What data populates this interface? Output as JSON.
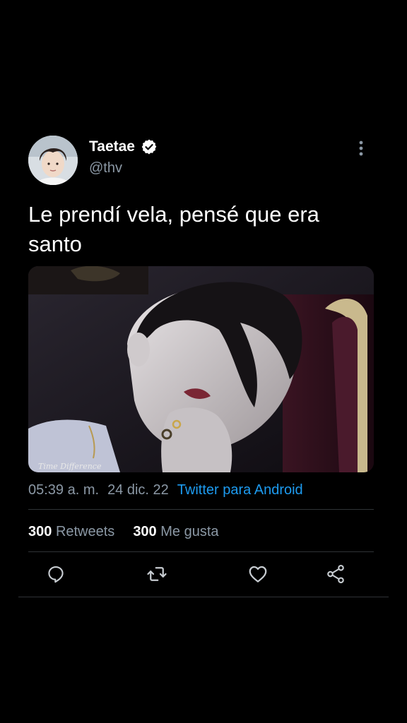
{
  "tweet": {
    "display_name": "Taetae",
    "handle": "@thv",
    "text": "Le prendí vela, pensé que era\nsanto",
    "media": {
      "watermark": "Time Difference"
    },
    "meta": {
      "time": "05:39 a. m.",
      "date": "24 dic. 22",
      "source": "Twitter para Android"
    },
    "stats": {
      "retweets_count": "300",
      "retweets_label": "Retweets",
      "likes_count": "300",
      "likes_label": "Me gusta"
    }
  },
  "icons": {
    "verified": "verified-badge-icon",
    "more": "more-vertical-icon",
    "reply": "reply-icon",
    "retweet": "retweet-icon",
    "like": "heart-icon",
    "share": "share-icon"
  },
  "colors": {
    "background": "#000000",
    "text_primary": "#ffffff",
    "text_secondary": "#8b98a5",
    "link": "#1d9bf0",
    "divider": "#2f3336"
  }
}
